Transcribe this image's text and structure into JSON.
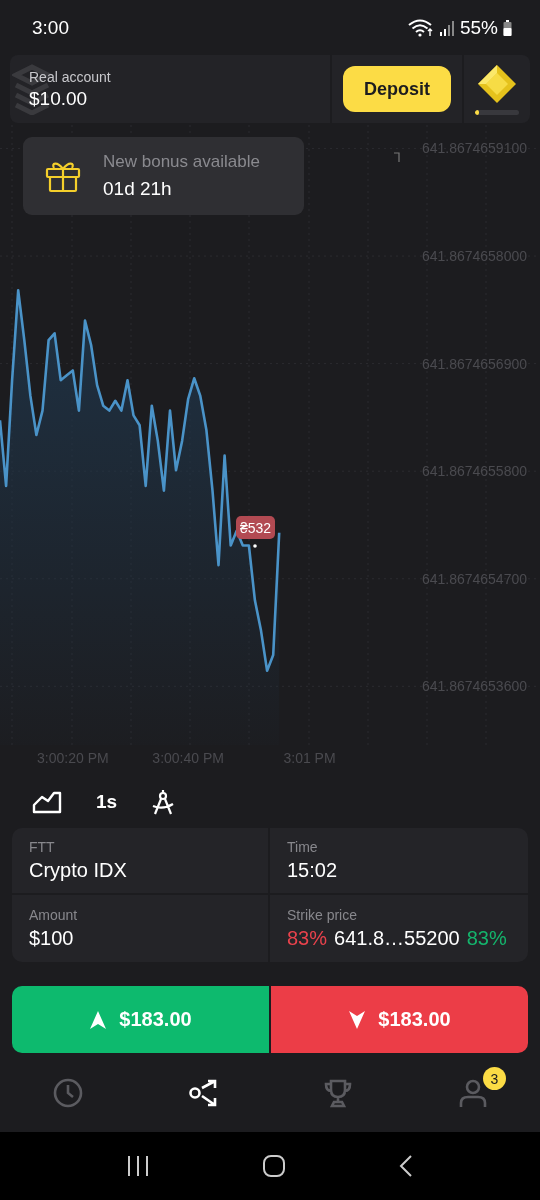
{
  "status_bar": {
    "time": "3:00",
    "battery": "55%"
  },
  "account": {
    "label": "Real account",
    "balance": "$10.00",
    "deposit": "Deposit",
    "level": 0.1
  },
  "bonus": {
    "title": "New bonus available",
    "countdown": "01d 21h"
  },
  "chart": {
    "price_badge": "₴532",
    "chart_data": {
      "type": "area",
      "categories": [
        null,
        null,
        null,
        null,
        null,
        null,
        null,
        null,
        null,
        null,
        null,
        null,
        "3:00:20 PM",
        null,
        null,
        null,
        null,
        null,
        null,
        null,
        null,
        null,
        null,
        null,
        null,
        null,
        null,
        null,
        null,
        null,
        null,
        "3:00:40 PM",
        null,
        null,
        null,
        null,
        null,
        null,
        null,
        null,
        null,
        null,
        null,
        null,
        null,
        null,
        null,
        null,
        null,
        null,
        null,
        "3:01 PM"
      ],
      "series": [
        {
          "color": "#4a93c8",
          "values": [
            641.867465632,
            641.867465565,
            641.867465673,
            641.867465765,
            641.867465714,
            641.867465657,
            641.867465617,
            641.867465642,
            641.867465714,
            641.867465721,
            641.867465673,
            641.867465678,
            641.867465683,
            641.867465642,
            641.867465734,
            641.867465709,
            641.867465668,
            641.867465647,
            641.867465642,
            641.867465652,
            641.867465642,
            641.867465673,
            641.867465637,
            641.867465627,
            641.867465565,
            641.867465647,
            641.867465611,
            641.86746556,
            641.867465642,
            641.867465581,
            641.867465611,
            641.867465654,
            641.867465675,
            641.867465657,
            641.867465622,
            641.86746556,
            641.867465484,
            641.867465596,
            641.867465504,
            641.867465519,
            641.867465504,
            641.867465504,
            641.867465448,
            641.867465417,
            641.867465376,
            641.867465392,
            641.867465517,
            null,
            null,
            null,
            null,
            null
          ]
        }
      ],
      "ylim": [
        641.8674653,
        641.867465934
      ],
      "grid": true,
      "yticks": [
        {
          "value": 641.86746591,
          "label": "641.8674659100"
        },
        {
          "value": 641.8674658,
          "label": "641.8674658000"
        },
        {
          "value": 641.86746569,
          "label": "641.8674656900"
        },
        {
          "value": 641.86746558,
          "label": "641.8674655800"
        },
        {
          "value": 641.86746547,
          "label": "641.8674654700"
        },
        {
          "value": 641.86746536,
          "label": "641.8674653600"
        }
      ]
    }
  },
  "toolbar": {
    "timeframe": "1s"
  },
  "trade": {
    "asset_label": "FTT",
    "asset": "Crypto IDX",
    "time_label": "Time",
    "time": "15:02",
    "amount_label": "Amount",
    "amount": "$100",
    "strike_label": "Strike price",
    "payout_down": "83%",
    "strike": "641.8…55200",
    "payout_up": "83%"
  },
  "buttons": [
    {
      "kind": "up",
      "label": "$183.00"
    },
    {
      "kind": "down",
      "label": "$183.00"
    }
  ],
  "nav": [
    {
      "kind": "history",
      "selected": false
    },
    {
      "kind": "trade",
      "selected": true
    },
    {
      "kind": "tournaments",
      "selected": false
    },
    {
      "kind": "profile",
      "selected": false,
      "badge": "3"
    }
  ]
}
